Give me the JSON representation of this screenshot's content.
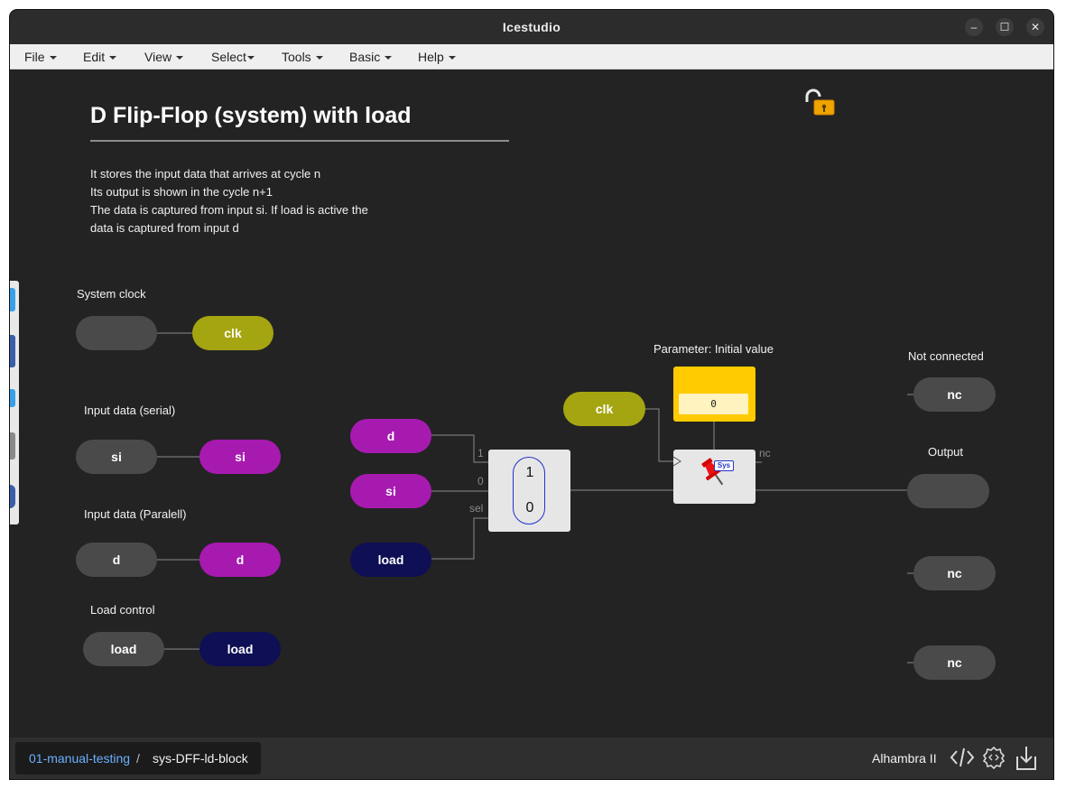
{
  "window": {
    "title": "Icestudio",
    "minimize_glyph": "–",
    "maximize_glyph": "☐",
    "close_glyph": "✕"
  },
  "menu": [
    "File",
    "Edit",
    "View",
    "Select",
    "Tools",
    "Basic",
    "Help"
  ],
  "canvas": {
    "heading": "D Flip-Flop (system) with load",
    "description": [
      "It stores the input data that arrives at cycle n",
      "Its output is shown in the cycle n+1",
      "The data is captured from input si. If load is active the",
      "data is captured from input d"
    ],
    "labels": {
      "system_clock": "System clock",
      "input_serial": "Input data (serial)",
      "input_parallel": "Input data (Paralell)",
      "load_control": "Load control",
      "parameter": "Parameter: Initial value",
      "not_connected": "Not connected",
      "output": "Output"
    },
    "pills": {
      "clk_input": "",
      "clk_label": "clk",
      "si_input": "si",
      "si_label": "si",
      "d_input": "d",
      "d_label": "d",
      "load_input": "load",
      "load_label": "load",
      "d_mid": "d",
      "si_mid": "si",
      "load_mid": "load",
      "clk_mid": "clk",
      "nc_top": "nc",
      "output": "",
      "nc_2": "nc",
      "nc_3": "nc"
    },
    "mux": {
      "in1": "1",
      "in0": "0",
      "top": "1",
      "bottom": "0",
      "sel": "sel"
    },
    "param_value": "0",
    "dff": {
      "badge": "Sys",
      "nc_pin": "nc"
    },
    "colors": {
      "gray": "#4a4a4a",
      "olive": "#a5a512",
      "magenta": "#a71ab0",
      "navy": "#0f0f55",
      "param": "#ffcb00"
    }
  },
  "statusbar": {
    "breadcrumb_project": "01-manual-testing",
    "breadcrumb_sep": "/",
    "breadcrumb_current": "sys-DFF-ld-block",
    "board": "Alhambra II"
  },
  "icons": [
    "lock-open-icon",
    "code-icon",
    "settings-cog-icon",
    "download-icon",
    "pushpin-icon"
  ]
}
